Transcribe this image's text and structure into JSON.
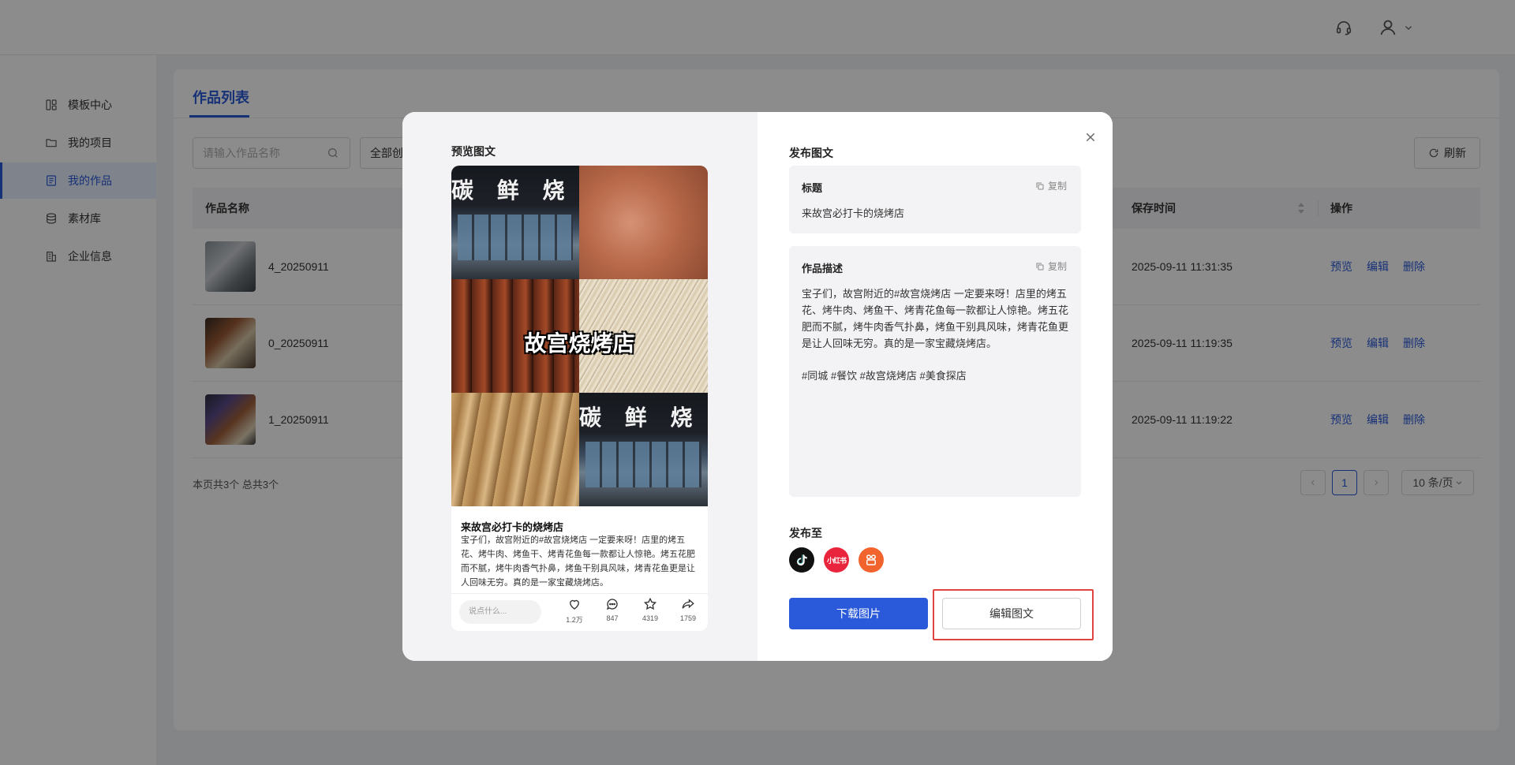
{
  "header": {
    "support_icon": "headset-icon",
    "user_icon": "user-icon"
  },
  "sidebar": {
    "items": [
      {
        "label": "模板中心",
        "icon": "template-icon"
      },
      {
        "label": "我的项目",
        "icon": "folder-icon"
      },
      {
        "label": "我的作品",
        "icon": "works-icon"
      },
      {
        "label": "素材库",
        "icon": "database-icon"
      },
      {
        "label": "企业信息",
        "icon": "building-icon"
      }
    ],
    "active_index": 2
  },
  "main": {
    "tab": "作品列表",
    "search_placeholder": "请输入作品名称",
    "filter_value": "全部创",
    "refresh_label": "刷新",
    "columns": {
      "name": "作品名称",
      "save_time": "保存时间",
      "actions": "操作"
    },
    "rows": [
      {
        "name": "4_20250911",
        "save_time": "2025-09-11 11:31:35"
      },
      {
        "name": "0_20250911",
        "save_time": "2025-09-11 11:19:35"
      },
      {
        "name": "1_20250911",
        "save_time": "2025-09-11 11:19:22"
      }
    ],
    "actions": {
      "preview": "预览",
      "edit": "编辑",
      "delete": "删除"
    },
    "summary": "本页共3个 总共3个",
    "pagination": {
      "current": "1",
      "page_size": "10 条/页"
    }
  },
  "modal": {
    "preview_label": "预览图文",
    "collage_sign": "碳 鲜 烧 烤",
    "collage_title": "故宫烧烤店",
    "preview": {
      "title": "来故宫必打卡的烧烤店",
      "body": "宝子们，故宫附近的#故宫烧烤店 一定要来呀！店里的烤五花、烤牛肉、烤鱼干、烤青花鱼每一款都让人惊艳。烤五花肥而不腻，烤牛肉香气扑鼻，烤鱼干别具风味，烤青花鱼更是让人回味无穷。真的是一家宝藏烧烤店。",
      "comment_placeholder": "说点什么...",
      "likes": "1.2万",
      "comments": "847",
      "favorites": "4319",
      "shares": "1759"
    },
    "publish_label": "发布图文",
    "title_field": {
      "label": "标题",
      "copy": "复制",
      "value": "来故宫必打卡的烧烤店"
    },
    "desc_field": {
      "label": "作品描述",
      "copy": "复制",
      "value": "宝子们，故宫附近的#故宫烧烤店 一定要来呀！店里的烤五花、烤牛肉、烤鱼干、烤青花鱼每一款都让人惊艳。烤五花肥而不腻，烤牛肉香气扑鼻，烤鱼干别具风味，烤青花鱼更是让人回味无穷。真的是一家宝藏烧烤店。",
      "tags": "#同城 #餐饮 #故宫烧烤店 #美食探店"
    },
    "publish_to_label": "发布至",
    "platforms": [
      {
        "name": "tiktok-icon",
        "color": "#111111"
      },
      {
        "name": "xiaohongshu-icon",
        "label": "小红书",
        "color": "#e8253c"
      },
      {
        "name": "kuaishou-icon",
        "color": "#f2642e"
      }
    ],
    "download_label": "下载图片",
    "edit_label": "编辑图文"
  },
  "colors": {
    "primary": "#2a59d9",
    "highlight": "#e0443e"
  }
}
